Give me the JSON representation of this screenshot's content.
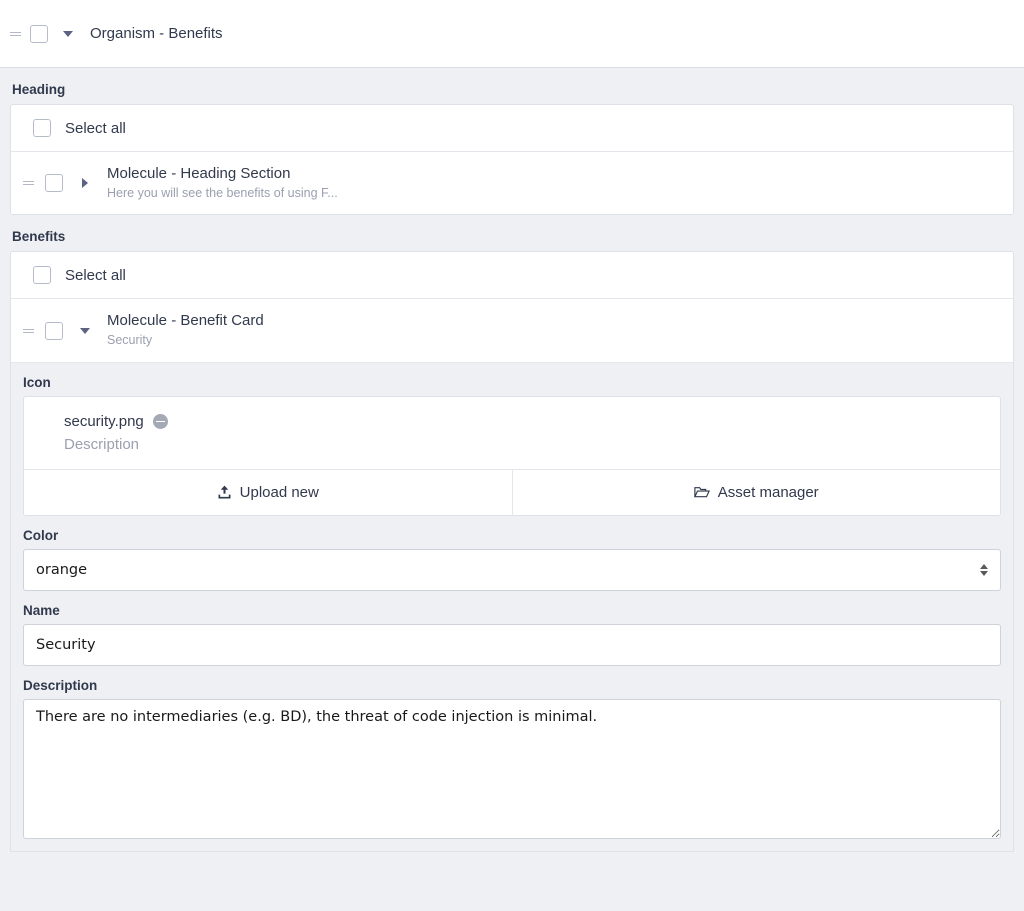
{
  "organism": {
    "title": "Organism - Benefits",
    "drag_handle_icon": "drag-handle-icon",
    "caret_icon": "chevron-down-icon"
  },
  "groups": [
    {
      "label": "Heading",
      "select_all_label": "Select all",
      "rows": [
        {
          "title": "Molecule - Heading Section",
          "subtitle": "Here you will see the benefits of using F...",
          "caret_icon": "chevron-right-icon",
          "expanded": false
        }
      ]
    },
    {
      "label": "Benefits",
      "select_all_label": "Select all",
      "rows": [
        {
          "title": "Molecule - Benefit Card",
          "subtitle": "Security",
          "caret_icon": "chevron-down-icon",
          "expanded": true
        }
      ]
    }
  ],
  "molecule_form": {
    "icon": {
      "label": "Icon",
      "asset_name": "security.png",
      "asset_description": "Description",
      "remove_icon": "minus-circle-icon",
      "upload_label": "Upload new",
      "upload_icon": "upload-icon",
      "asset_manager_label": "Asset manager",
      "asset_manager_icon": "folder-icon"
    },
    "color": {
      "label": "Color",
      "value": "orange",
      "options": [
        "orange"
      ]
    },
    "name": {
      "label": "Name",
      "value": "Security",
      "placeholder": ""
    },
    "description": {
      "label": "Description",
      "value": "There are no intermediaries (e.g. BD), the threat of code injection is minimal.",
      "placeholder": ""
    }
  }
}
